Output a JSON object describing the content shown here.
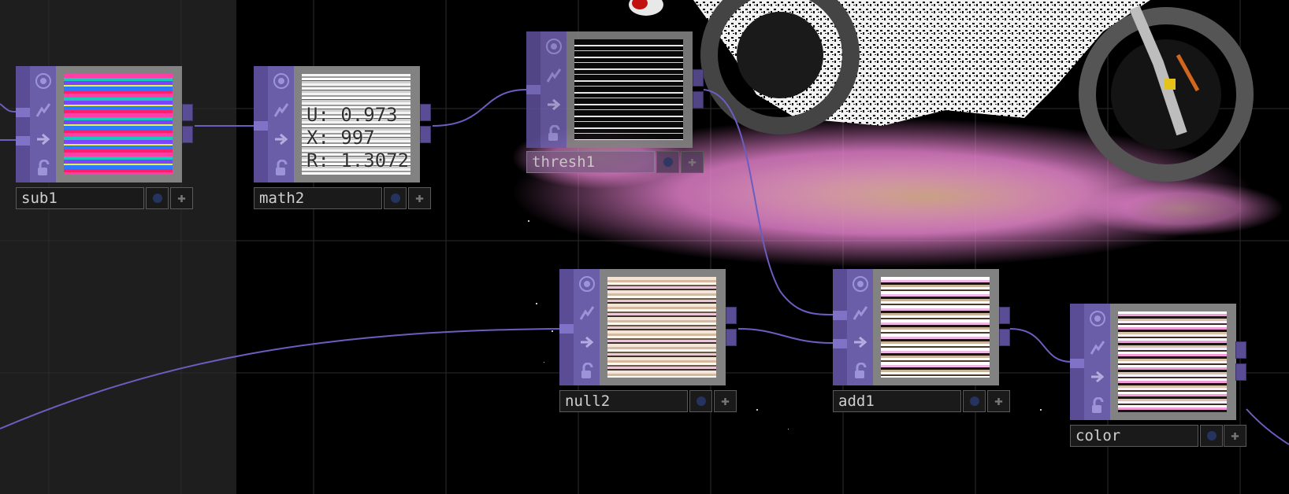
{
  "app": "TouchDesigner network editor",
  "icons": {
    "viewer": "viewer-toggle-icon",
    "cooking": "cooking-bypass-icon",
    "export": "display-flag-icon",
    "lock": "lock-icon",
    "viewer_active": "viewer-active-icon",
    "add": "add-plus-icon"
  },
  "colors": {
    "background": "#000000",
    "left_pane": "#1e1e1e",
    "top_operator": "#6b5ea8",
    "wire": "#6a5ec0"
  },
  "nodes": [
    {
      "id": "sub1",
      "name": "sub1"
    },
    {
      "id": "math2",
      "name": "math2",
      "overlay": [
        "U: 0.973",
        "X: 997",
        "R: 1.3072"
      ]
    },
    {
      "id": "thresh1",
      "name": "thresh1"
    },
    {
      "id": "null2",
      "name": "null2"
    },
    {
      "id": "add1",
      "name": "add1"
    },
    {
      "id": "color",
      "name": "color"
    }
  ]
}
